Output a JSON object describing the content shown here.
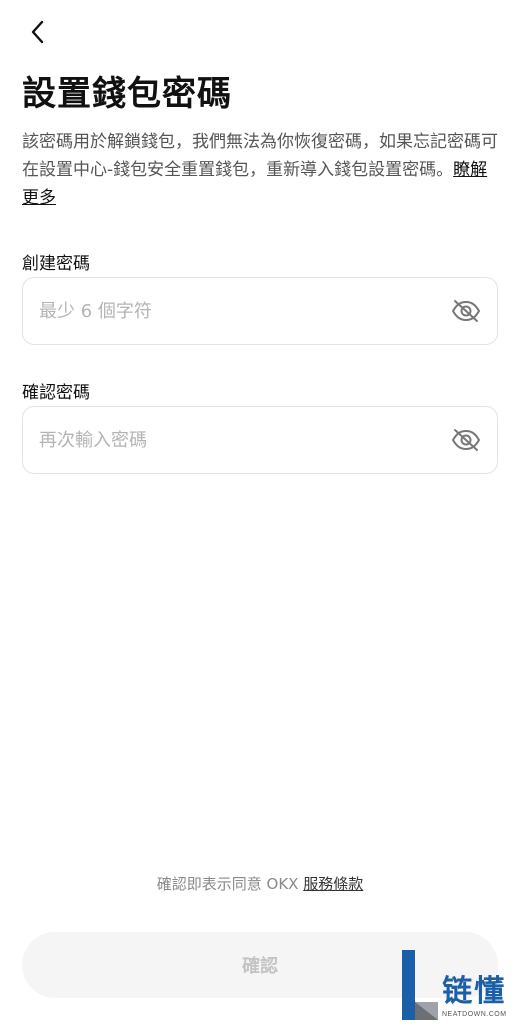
{
  "header": {
    "back_icon": "chevron-left-icon",
    "title": "設置錢包密碼"
  },
  "description": {
    "text": "該密碼用於解鎖錢包，我們無法為你恢復密碼，如果忘記密碼可在設置中心-錢包安全重置錢包，重新導入錢包設置密碼。",
    "link": "瞭解更多"
  },
  "create_password": {
    "label": "創建密碼",
    "placeholder": "最少 6 個字符",
    "value": "",
    "toggle_icon": "eye-off-icon"
  },
  "confirm_password": {
    "label": "確認密碼",
    "placeholder": "再次輸入密碼",
    "value": "",
    "toggle_icon": "eye-off-icon"
  },
  "terms": {
    "text": "確認即表示同意 OKX ",
    "link": "服務條款"
  },
  "confirm_button": {
    "label": "確認",
    "enabled": false
  },
  "watermark": {
    "brand_cn": "链懂",
    "brand_en": "NEATDOWN.COM"
  },
  "colors": {
    "text_primary": "#111111",
    "text_secondary": "#555555",
    "placeholder": "#b4b4b4",
    "field_border": "#e3e3e3",
    "button_disabled_bg": "#f5f5f5",
    "button_disabled_text": "#c4c4c4",
    "watermark_blue": "#1b5fa8"
  }
}
